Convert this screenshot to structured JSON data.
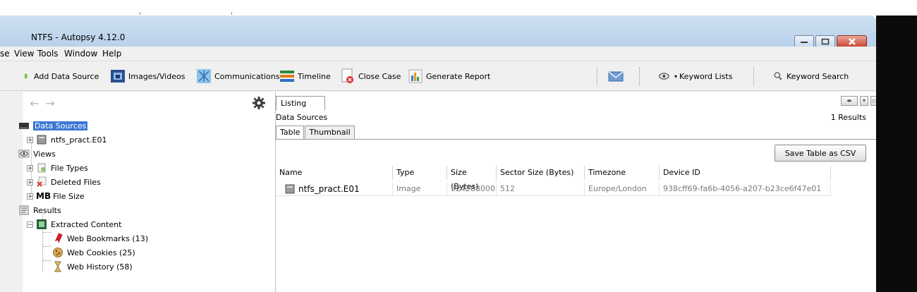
{
  "window": {
    "title": "NTFS - Autopsy 4.12.0"
  },
  "menu": {
    "items": [
      "se",
      "View",
      "Tools",
      "Window",
      "Help"
    ]
  },
  "toolbar": {
    "add_data_source": "Add Data Source",
    "images_videos": "Images/Videos",
    "communications": "Communications",
    "timeline": "Timeline",
    "close_case": "Close Case",
    "generate_report": "Generate Report",
    "keyword_lists": "Keyword Lists",
    "keyword_search": "Keyword Search"
  },
  "tree": {
    "data_sources": "Data Sources",
    "image_file": "ntfs_pract.E01",
    "views": "Views",
    "file_types": "File Types",
    "deleted_files": "Deleted Files",
    "file_size_prefix": "MB",
    "file_size": "File Size",
    "results": "Results",
    "extracted_content": "Extracted Content",
    "web_bookmarks": "Web Bookmarks (13)",
    "web_cookies": "Web Cookies (25)",
    "web_history": "Web History (58)"
  },
  "listing": {
    "tab": "Listing",
    "heading": "Data Sources",
    "results_count": "1 Results",
    "tabs": [
      "Table",
      "Thumbnail"
    ],
    "save_csv": "Save Table as CSV",
    "columns": [
      "Name",
      "Type",
      "Size (Bytes)",
      "Sector Size (Bytes)",
      "Timezone",
      "Device ID"
    ],
    "rows": [
      [
        "ntfs_pract.E01",
        "Image",
        "524288000",
        "512",
        "Europe/London",
        "938cff69-fa6b-4056-a207-b23ce6f47e01"
      ]
    ]
  },
  "colors": {
    "selection": "#3b78d4",
    "titlebar": "#bfd5ec",
    "close_button": "#c7402a"
  }
}
